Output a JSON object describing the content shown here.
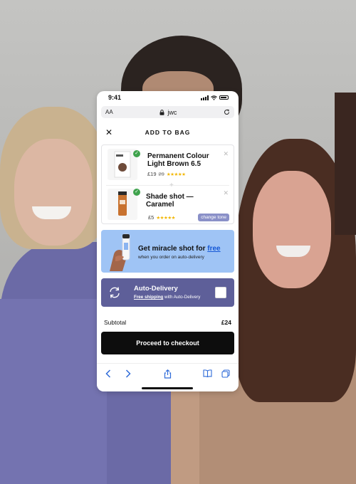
{
  "status_bar": {
    "time": "9:41"
  },
  "browser": {
    "text_size_label": "AA",
    "url": "jwc"
  },
  "sheet": {
    "title": "ADD TO BAG"
  },
  "products": [
    {
      "name_line1": "Permanent Colour",
      "name_line2": "Light Brown 6.5",
      "price": "£19",
      "old_price": "29",
      "stars": "★★★★★"
    },
    {
      "name_line1": "Shade shot —",
      "name_line2": "Caramel",
      "price": "£5",
      "stars": "★★★★★",
      "action_label": "change tone"
    }
  ],
  "promo": {
    "title_prefix": "Get miracle shot for ",
    "title_link": "free",
    "subtitle": "when you order on auto-delivery"
  },
  "auto_delivery": {
    "title": "Auto-Delivery",
    "sub_link": "Free shipping",
    "sub_text": " with Auto-Delivery"
  },
  "summary": {
    "subtotal_label": "Subtotal",
    "subtotal_value": "£24"
  },
  "checkout": {
    "label": "Proceed to checkout"
  },
  "colors": {
    "accent_blue": "#1558d6",
    "auto_delivery_bg": "#5e5f99",
    "promo_bg": "#9fc4f5",
    "checkout_bg": "#0d0d0d"
  }
}
